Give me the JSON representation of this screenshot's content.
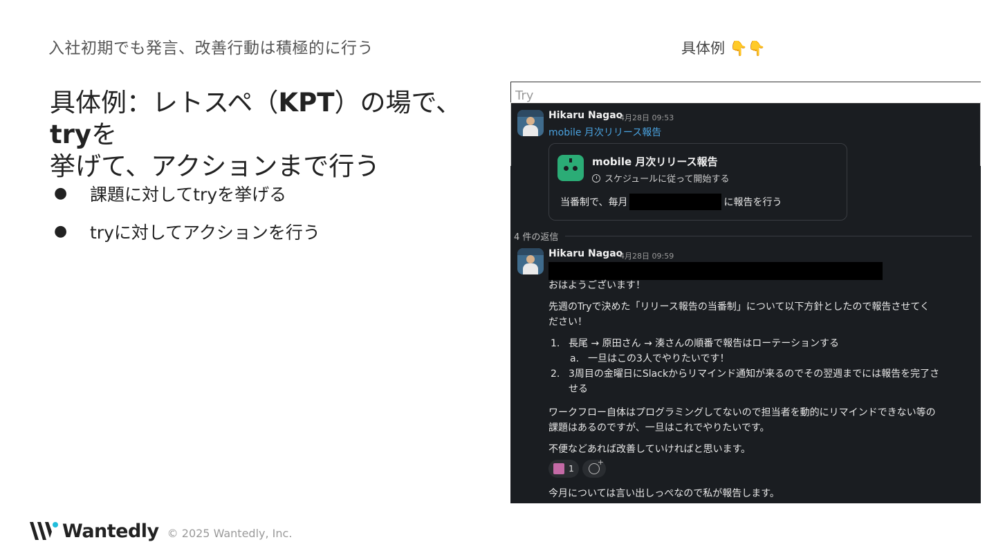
{
  "slide": {
    "subtitle": "入社初期でも発言、改善行動は積極的に行う",
    "example_label": "具体例",
    "example_emoji": "👇👇",
    "title_line1_a": "具体例：レトスペ（",
    "title_line1_b": "KPT",
    "title_line1_c": "）の場で、",
    "title_line1_d": "try",
    "title_line1_e": "を",
    "title_line2": "挙げて、アクションまで行う",
    "bullets": [
      {
        "marker": "●",
        "text": "課題に対してtryを挙げる"
      },
      {
        "marker": "●",
        "text": "tryに対してアクションを行う"
      }
    ]
  },
  "footer": {
    "logo_text": "Wantedly",
    "copyright": "© 2025 Wantedly, Inc."
  },
  "slack": {
    "top_tab_label": "Try",
    "parent": {
      "author": "Hikaru Nagao",
      "time": "4月28日 09:53",
      "link": "mobile 月次リリース報告",
      "card_title": "mobile 月次リリース報告",
      "card_subtitle": "スケジュールに従って開始する",
      "card_body_prefix": "当番制で、毎月",
      "card_body_suffix": "に報告を行う"
    },
    "reply_count": "4 件の返信",
    "reply": {
      "author": "Hikaru Nagao",
      "time": "4月28日 09:59",
      "greeting": "おはようございます！",
      "para1_line1": "先週のTryで決めた「リリース報告の当番制」について以下方針としたので報告させてく",
      "para1_line2": "ださい！",
      "list": [
        {
          "num": "1.",
          "text": "長尾 → 原田さん → 湊さんの順番で報告はローテーションする"
        },
        {
          "num": "a.",
          "text": "一旦はこの3人でやりたいです！"
        },
        {
          "num": "2.",
          "text": "3周目の金曜日にSlackからリマインド通知が来るのでその翌週までには報告を完了さ"
        },
        {
          "num": "",
          "text": "せる"
        }
      ],
      "para2_line1": "ワークフロー自体はプログラミングしてないので担当者を動的にリマインドできない等の",
      "para2_line2": "課題はあるのですが、一旦はこれでやりたいです。",
      "para3": "不便などあれば改善していければと思います。",
      "reaction_count": "1",
      "para4": "今月については言い出しっぺなので私が報告します。"
    }
  }
}
